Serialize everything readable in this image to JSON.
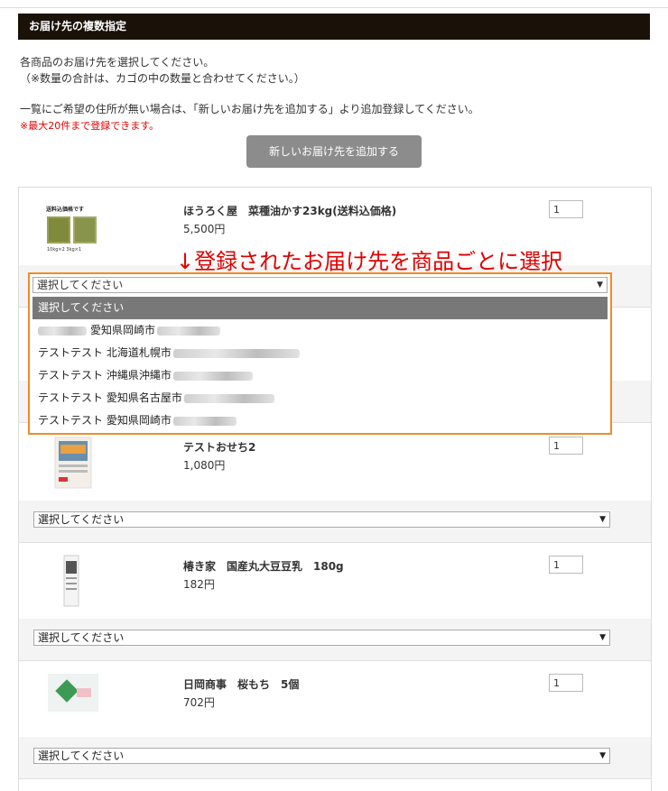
{
  "header": {
    "title": "お届け先の複数指定"
  },
  "intro": {
    "line1": "各商品のお届け先を選択してください。",
    "line2": "（※数量の合計は、カゴの中の数量と合わせてください。）",
    "line3": "一覧にご希望の住所が無い場合は、「新しいお届け先を追加する」より追加登録してください。",
    "warning": "※最大20件まで登録できます。"
  },
  "add_button": "新しいお届け先を追加する",
  "annotation": "↓登録されたお届け先を商品ごとに選択",
  "select_placeholder": "選択してください",
  "items": [
    {
      "name": "ほうろく屋　菜種油かす23kg(送料込価格)",
      "price": "5,500円",
      "qty": "1",
      "thumb_text": "送料込価格です",
      "thumb_sub": "10kg×2 3kg×1"
    },
    {
      "name": "テストおせち2",
      "price": "1,080円",
      "qty": "1"
    },
    {
      "name": "椿き家　国産丸大豆豆乳　180g",
      "price": "182円",
      "qty": "1"
    },
    {
      "name": "日岡商事　桜もち　5個",
      "price": "702円",
      "qty": "1"
    }
  ],
  "dropdown_options": [
    "選択してください",
    "愛知県岡崎市",
    "テストテスト 北海道札幌市",
    "テストテスト 沖縄県沖縄市",
    "テストテスト 愛知県名古屋市",
    "テストテスト 愛知県岡崎市"
  ],
  "colors": {
    "header_bg": "#1a1209",
    "accent_red": "#e60000",
    "dropdown_border": "#f08c28",
    "button_bg": "#8c8c8c"
  }
}
